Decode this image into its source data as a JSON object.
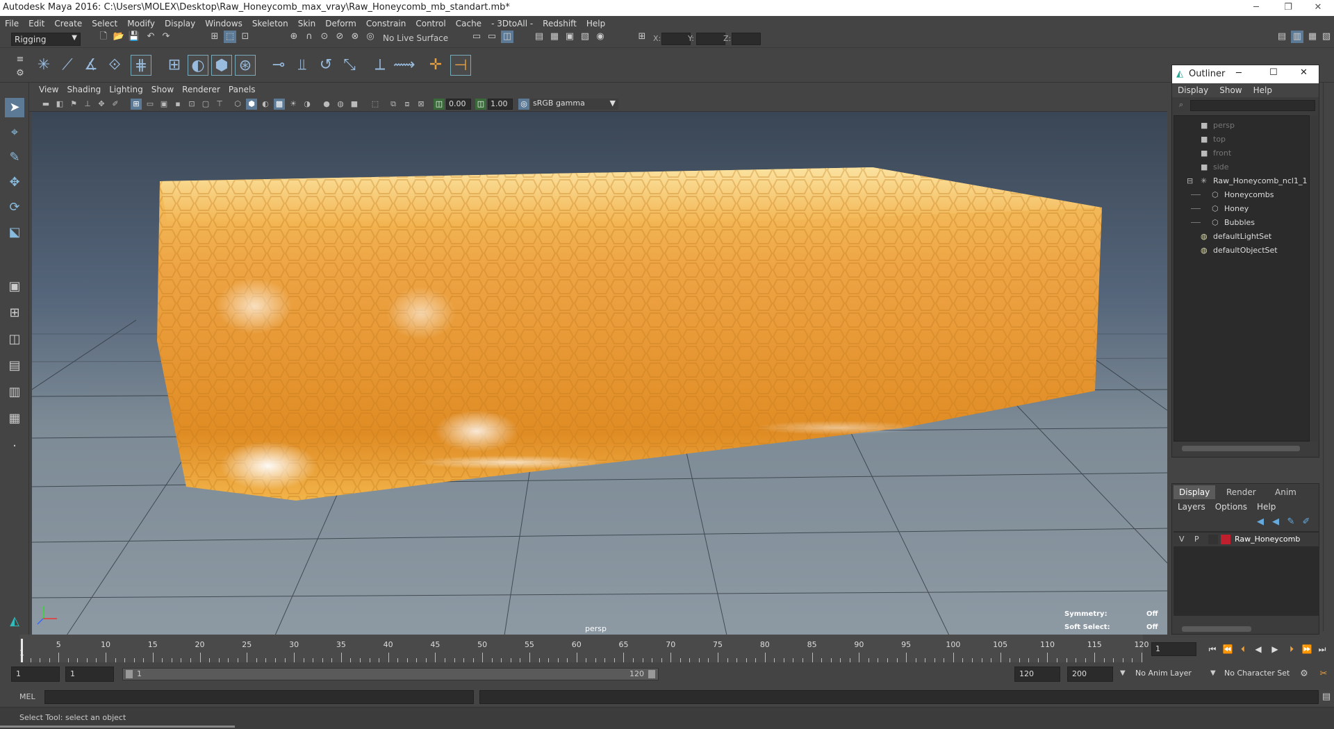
{
  "window": {
    "title": "Autodesk Maya 2016: C:\\Users\\MOLEX\\Desktop\\Raw_Honeycomb_max_vray\\Raw_Honeycomb_mb_standart.mb*",
    "minimize": "─",
    "restore": "❐",
    "close": "✕"
  },
  "menubar": [
    "File",
    "Edit",
    "Create",
    "Select",
    "Modify",
    "Display",
    "Windows",
    "Skeleton",
    "Skin",
    "Deform",
    "Constrain",
    "Control",
    "Cache",
    "- 3DtoAll -",
    "Redshift",
    "Help"
  ],
  "statusline": {
    "menu_set": "Rigging",
    "live_surface": "No Live Surface",
    "x_label": "X:",
    "y_label": "Y:",
    "z_label": "Z:"
  },
  "viewport": {
    "menus": [
      "View",
      "Shading",
      "Lighting",
      "Show",
      "Renderer",
      "Panels"
    ],
    "exposure": "0.00",
    "gamma": "1.00",
    "color_space": "sRGB gamma",
    "camera_label": "persp",
    "hud": {
      "symmetry_label": "Symmetry:",
      "symmetry_value": "Off",
      "soft_select_label": "Soft Select:",
      "soft_select_value": "Off"
    }
  },
  "outliner": {
    "title": "Outliner",
    "menus": [
      "Display",
      "Show",
      "Help"
    ],
    "items": [
      {
        "label": "persp",
        "icon": "camera-icon",
        "dim": true
      },
      {
        "label": "top",
        "icon": "camera-icon",
        "dim": true
      },
      {
        "label": "front",
        "icon": "camera-icon",
        "dim": true
      },
      {
        "label": "side",
        "icon": "camera-icon",
        "dim": true
      },
      {
        "label": "Raw_Honeycomb_ncl1_1",
        "icon": "joint-icon",
        "dim": false
      },
      {
        "label": "Honeycombs",
        "icon": "mesh-icon",
        "dim": false
      },
      {
        "label": "Honey",
        "icon": "mesh-icon",
        "dim": false
      },
      {
        "label": "Bubbles",
        "icon": "mesh-icon",
        "dim": false
      },
      {
        "label": "defaultLightSet",
        "icon": "set-icon",
        "dim": false
      },
      {
        "label": "defaultObjectSet",
        "icon": "set-icon",
        "dim": false
      }
    ]
  },
  "layer_editor": {
    "tabs": [
      "Display",
      "Render",
      "Anim"
    ],
    "menus": [
      "Layers",
      "Options",
      "Help"
    ],
    "layer": {
      "v": "V",
      "p": "P",
      "name": "Raw_Honeycomb",
      "color": "#c0202e"
    }
  },
  "timeline": {
    "labels": [
      "5",
      "10",
      "15",
      "20",
      "25",
      "30",
      "35",
      "40",
      "45",
      "50",
      "55",
      "60",
      "65",
      "70",
      "75",
      "80",
      "85",
      "90",
      "95",
      "100",
      "105",
      "110",
      "115",
      "120"
    ],
    "start_marker": "1",
    "current_frame": "1"
  },
  "range": {
    "start": "1",
    "playback_start": "1",
    "slider_start": "1",
    "slider_end": "120",
    "playback_end": "120",
    "end": "200",
    "anim_layer": "No Anim Layer",
    "character_set": "No Character Set"
  },
  "command": {
    "language": "MEL"
  },
  "help_line": "Select Tool: select an object",
  "colors": {
    "honey": "#f0a030",
    "accent": "#5c7a96"
  }
}
